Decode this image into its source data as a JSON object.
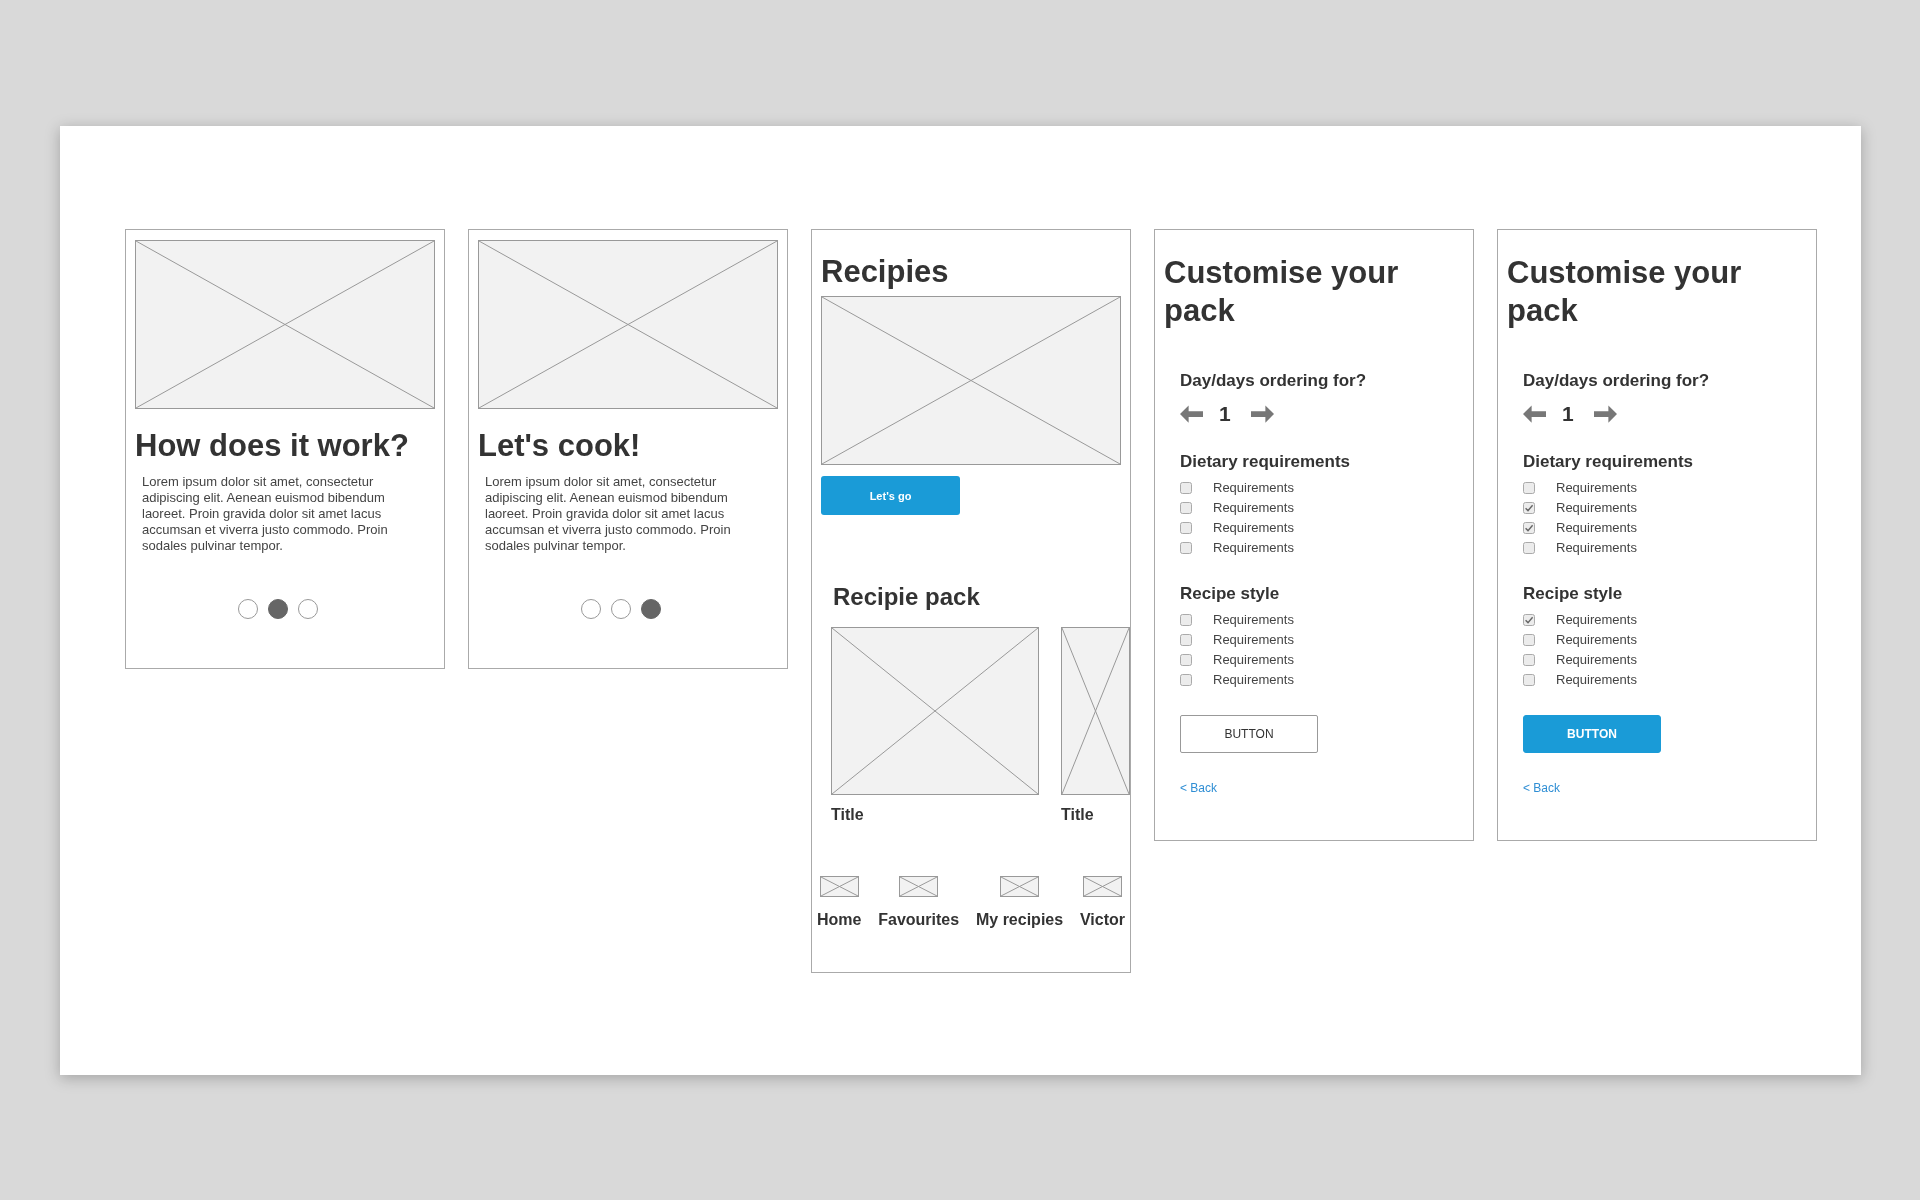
{
  "screens": [
    {
      "kind": "intro",
      "title": "How does it work?",
      "body": "Lorem ipsum dolor sit amet, consectetur adipiscing elit. Aenean euismod bibendum laoreet. Proin gravida dolor sit amet lacus accumsan et viverra justo commodo. Proin sodales pulvinar tempor.",
      "pager": [
        {
          "selected": false
        },
        {
          "selected": true
        },
        {
          "selected": false
        }
      ]
    },
    {
      "kind": "intro",
      "title": "Let's cook!",
      "body": "Lorem ipsum dolor sit amet, consectetur adipiscing elit. Aenean euismod bibendum laoreet. Proin gravida dolor sit amet lacus accumsan et viverra justo commodo. Proin sodales pulvinar tempor.",
      "pager": [
        {
          "selected": false
        },
        {
          "selected": false
        },
        {
          "selected": true
        }
      ]
    },
    {
      "kind": "recipes",
      "title": "Recipies",
      "button": "Let's go",
      "pack_title": "Recipie pack",
      "pack_items": [
        {
          "title": "Title"
        },
        {
          "title": "Title"
        }
      ],
      "nav": [
        {
          "label": "Home"
        },
        {
          "label": "Favourites"
        },
        {
          "label": "My recipies"
        },
        {
          "label": "Victor"
        }
      ]
    },
    {
      "kind": "customise",
      "title": "Customise your pack",
      "days_label": "Day/days ordering for?",
      "days_value": "1",
      "groups": [
        {
          "label": "Dietary requirements",
          "options": [
            {
              "label": "Requirements",
              "checked": false
            },
            {
              "label": "Requirements",
              "checked": false
            },
            {
              "label": "Requirements",
              "checked": false
            },
            {
              "label": "Requirements",
              "checked": false
            }
          ]
        },
        {
          "label": "Recipe style",
          "options": [
            {
              "label": "Requirements",
              "checked": false
            },
            {
              "label": "Requirements",
              "checked": false
            },
            {
              "label": "Requirements",
              "checked": false
            },
            {
              "label": "Requirements",
              "checked": false
            }
          ]
        }
      ],
      "button": {
        "label": "BUTTON",
        "primary": false
      },
      "back_link": "< Back"
    },
    {
      "kind": "customise",
      "title": "Customise your pack",
      "days_label": "Day/days ordering for?",
      "days_value": "1",
      "groups": [
        {
          "label": "Dietary requirements",
          "options": [
            {
              "label": "Requirements",
              "checked": false
            },
            {
              "label": "Requirements",
              "checked": true
            },
            {
              "label": "Requirements",
              "checked": true
            },
            {
              "label": "Requirements",
              "checked": false
            }
          ]
        },
        {
          "label": "Recipe style",
          "options": [
            {
              "label": "Requirements",
              "checked": true
            },
            {
              "label": "Requirements",
              "checked": false
            },
            {
              "label": "Requirements",
              "checked": false
            },
            {
              "label": "Requirements",
              "checked": false
            }
          ]
        }
      ],
      "button": {
        "label": "BUTTON",
        "primary": true
      },
      "back_link": "< Back"
    }
  ]
}
